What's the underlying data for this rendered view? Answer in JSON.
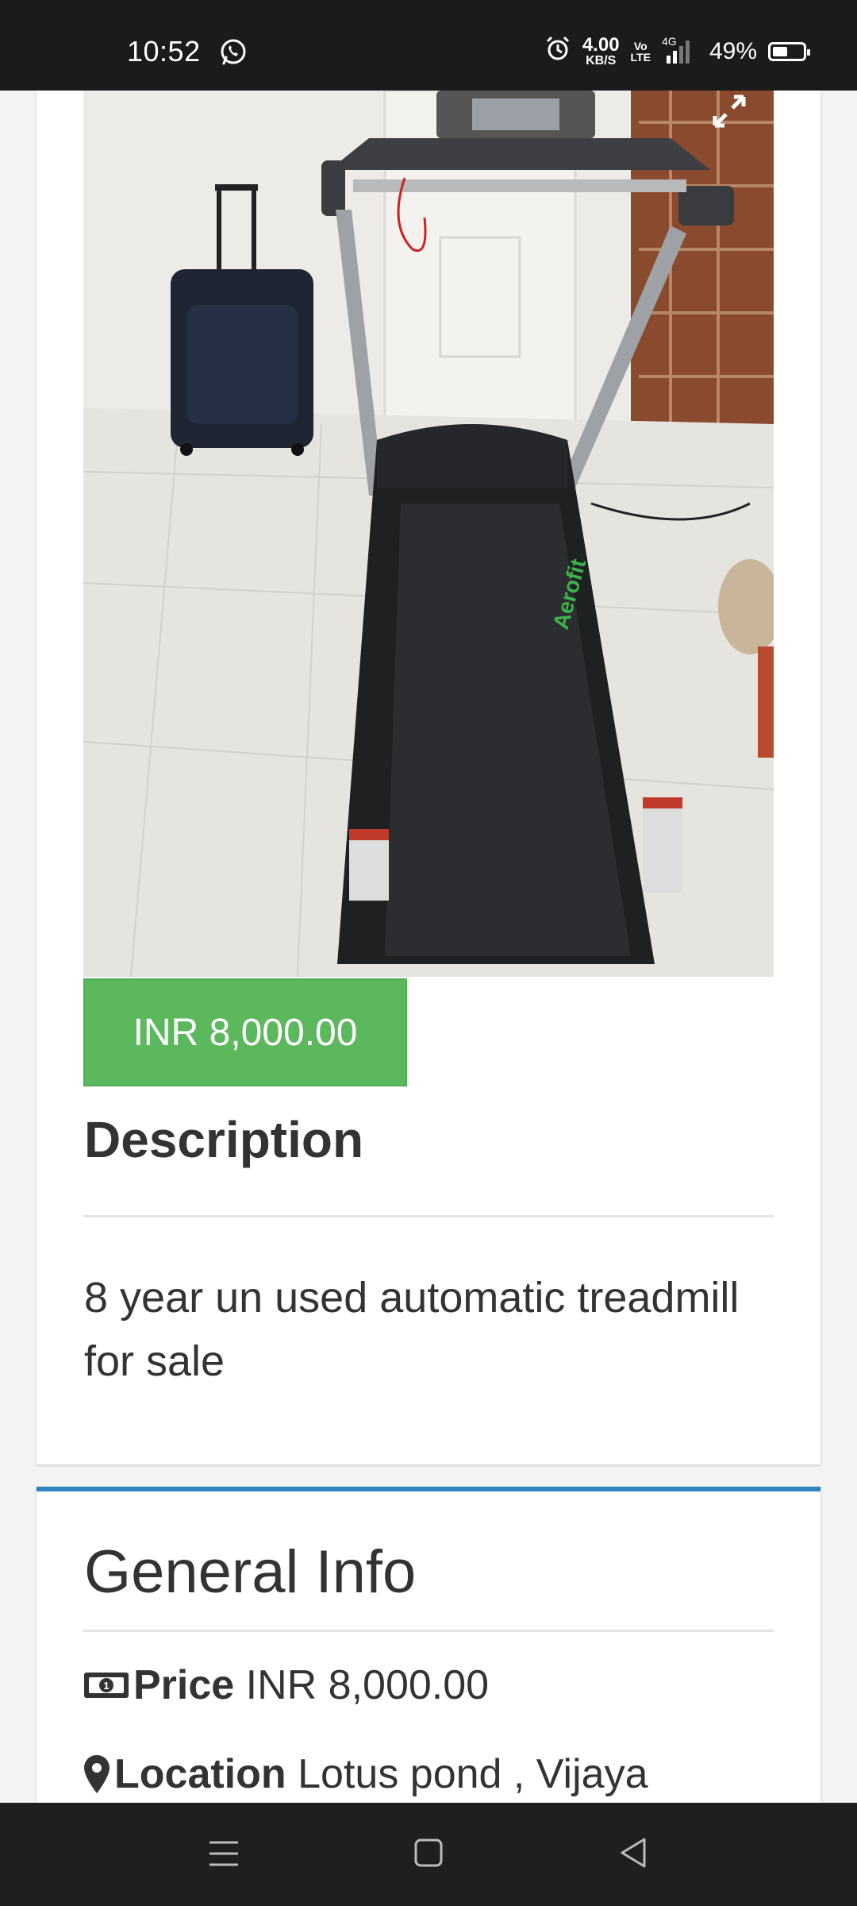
{
  "status_bar": {
    "time": "10:52",
    "net_speed_value": "4.00",
    "net_speed_unit": "KB/S",
    "volte_top": "Vo",
    "volte_bottom": "LTE",
    "network": "4G",
    "battery_percent": "49%",
    "battery_level": 0.49
  },
  "listing": {
    "price_badge": "INR 8,000.00",
    "description_heading": "Description",
    "description_text": "8 year un used automatic treadmill for sale"
  },
  "general_info": {
    "heading": "General Info",
    "price_label": "Price",
    "price_value": "INR 8,000.00",
    "location_label": "Location",
    "location_value": "Lotus pond , Vijaya"
  },
  "colors": {
    "price_badge_bg": "#5cb85c",
    "card_accent": "#2e86c1",
    "status_bar_bg": "#1b1b1b"
  },
  "icons": [
    "whatsapp-icon",
    "alarm-icon",
    "signal-icon",
    "battery-icon",
    "expand-icon",
    "money-icon",
    "map-marker-icon",
    "menu-icon",
    "home-icon",
    "back-icon"
  ]
}
